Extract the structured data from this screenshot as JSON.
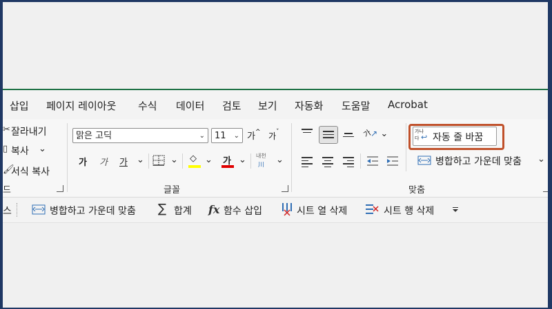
{
  "menu": {
    "tabs": [
      "삽입",
      "페이지 레이아웃",
      "수식",
      "데이터",
      "검토",
      "보기",
      "자동화",
      "도움말",
      "Acrobat"
    ]
  },
  "clipboard": {
    "cut": "잘라내기",
    "copy": "복사",
    "format_painter": "서식 복사",
    "group_label": "드"
  },
  "font": {
    "font_name": "맑은 고딕",
    "font_size": "11",
    "grow_label": "가",
    "shrink_label": "가",
    "bold": "가",
    "italic": "가",
    "underline": "가",
    "font_color_label": "가",
    "phonetic_top": "내천",
    "phonetic_bottom": "川",
    "group_label": "글꼴",
    "highlight_color": "#ffff00",
    "font_color": "#e00000"
  },
  "alignment": {
    "wrap_text_label": "자동 줄 바꿈",
    "wrap_icon_top": "가나",
    "wrap_icon_bottom": "다",
    "orientation_label": "가",
    "merge_label": "병합하고 가운데 맞춤",
    "group_label": "맞춤",
    "highlight_color": "#c0502a"
  },
  "qat": {
    "partial": "스",
    "merge_center": "병합하고 가운데 맞춤",
    "sum_symbol": "∑",
    "sum": "합계",
    "insert_function": "함수 삽입",
    "fx_symbol": "fx",
    "delete_column": "시트 열 삭제",
    "delete_row": "시트 행 삭제"
  }
}
